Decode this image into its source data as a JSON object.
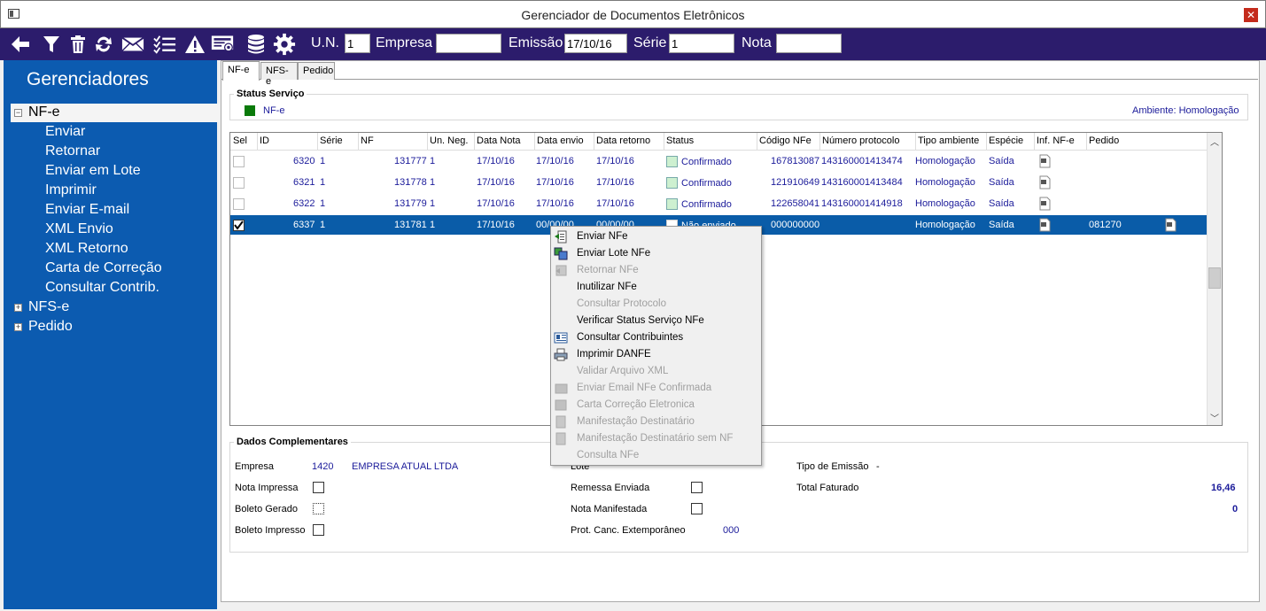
{
  "window": {
    "title": "Gerenciador de Documentos Eletrônicos",
    "close_glyph": "✕"
  },
  "toolbar": {
    "icons": [
      "back-arrow-icon",
      "filter-icon",
      "trash-icon",
      "refresh-icon",
      "envelope-icon",
      "checklist-icon",
      "warning-icon",
      "certificate-icon",
      "database-icon",
      "gear-icon"
    ],
    "un_label": "U.N.",
    "un_value": "1",
    "empresa_label": "Empresa",
    "empresa_value": "",
    "emissao_label": "Emissão",
    "emissao_value": "17/10/16",
    "serie_label": "Série",
    "serie_value": "1",
    "nota_label": "Nota",
    "nota_value": ""
  },
  "sidebar": {
    "title": "Gerenciadores",
    "nodes": [
      {
        "label": "NF-e",
        "expanded": true,
        "items": [
          "Enviar",
          "Retornar",
          "Enviar em Lote",
          "Imprimir",
          "Enviar E-mail",
          "XML Envio",
          "XML Retorno",
          "Carta de Correção",
          "Consultar Contrib."
        ]
      },
      {
        "label": "NFS-e",
        "expanded": false
      },
      {
        "label": "Pedido",
        "expanded": false
      }
    ],
    "collapse_glyph": "−",
    "expand_glyph": "+"
  },
  "tabs": [
    "NF-e",
    "NFS-e",
    "Pedido"
  ],
  "status_servico": {
    "title": "Status Serviço",
    "item_label": "NF-e",
    "ambiente": "Ambiente: Homologação",
    "color": "#0a7a0a"
  },
  "grid": {
    "columns": [
      "Sel",
      "ID",
      "Série",
      "NF",
      "Un. Neg.",
      "Data Nota",
      "Data envio",
      "Data retorno",
      "Status",
      "Código NFe",
      "Número protocolo",
      "Tipo ambiente",
      "Espécie",
      "Inf. NF-e",
      "Pedido"
    ],
    "rows": [
      {
        "sel": false,
        "id": "6320",
        "serie": "1",
        "nf": "131777",
        "un": "1",
        "data_nota": "17/10/16",
        "data_envio": "17/10/16",
        "data_retorno": "17/10/16",
        "status": "Confirmado",
        "codigo": "167813087",
        "protocolo": "143160001413474",
        "ambiente": "Homologação",
        "especie": "Saída",
        "pedido": ""
      },
      {
        "sel": false,
        "id": "6321",
        "serie": "1",
        "nf": "131778",
        "un": "1",
        "data_nota": "17/10/16",
        "data_envio": "17/10/16",
        "data_retorno": "17/10/16",
        "status": "Confirmado",
        "codigo": "121910649",
        "protocolo": "143160001413484",
        "ambiente": "Homologação",
        "especie": "Saída",
        "pedido": ""
      },
      {
        "sel": false,
        "id": "6322",
        "serie": "1",
        "nf": "131779",
        "un": "1",
        "data_nota": "17/10/16",
        "data_envio": "17/10/16",
        "data_retorno": "17/10/16",
        "status": "Confirmado",
        "codigo": "122658041",
        "protocolo": "143160001414918",
        "ambiente": "Homologação",
        "especie": "Saída",
        "pedido": ""
      },
      {
        "sel": true,
        "id": "6337",
        "serie": "1",
        "nf": "131781",
        "un": "1",
        "data_nota": "17/10/16",
        "data_envio": "00/00/00",
        "data_retorno": "00/00/00",
        "status": "Não enviado",
        "codigo": "000000000",
        "protocolo": "",
        "ambiente": "Homologação",
        "especie": "Saída",
        "pedido": "081270"
      }
    ]
  },
  "context_menu": [
    {
      "label": "Enviar NFe",
      "enabled": true,
      "icon": "send-icon"
    },
    {
      "label": "Enviar Lote NFe",
      "enabled": true,
      "icon": "send-batch-icon"
    },
    {
      "label": "Retornar NFe",
      "enabled": false,
      "icon": "return-icon"
    },
    {
      "label": "Inutilizar NFe",
      "enabled": true,
      "icon": ""
    },
    {
      "label": "Consultar Protocolo",
      "enabled": false,
      "icon": ""
    },
    {
      "label": "Verificar Status Serviço NFe",
      "enabled": true,
      "icon": ""
    },
    {
      "label": "Consultar Contribuintes",
      "enabled": true,
      "icon": "contact-card-icon"
    },
    {
      "label": "Imprimir DANFE",
      "enabled": true,
      "icon": "printer-icon"
    },
    {
      "label": "Validar Arquivo XML",
      "enabled": false,
      "icon": ""
    },
    {
      "label": "Enviar Email NFe Confirmada",
      "enabled": false,
      "icon": "email-icon"
    },
    {
      "label": "Carta Correção Eletronica",
      "enabled": false,
      "icon": "letter-icon"
    },
    {
      "label": "Manifestação Destinatário",
      "enabled": false,
      "icon": "manifest-icon"
    },
    {
      "label": "Manifestação Destinatário sem NF",
      "enabled": false,
      "icon": "manifest-icon"
    },
    {
      "label": "Consulta NFe",
      "enabled": false,
      "icon": ""
    }
  ],
  "dados": {
    "title": "Dados Complementares",
    "empresa_label": "Empresa",
    "empresa_code": "1420",
    "empresa_name": "EMPRESA ATUAL LTDA",
    "nota_impressa_label": "Nota Impressa",
    "boleto_gerado_label": "Boleto Gerado",
    "boleto_impresso_label": "Boleto Impresso",
    "lote_label": "Lote",
    "remessa_label": "Remessa Enviada",
    "nota_manifestada_label": "Nota Manifestada",
    "prot_label": "Prot. Canc. Extemporâneo",
    "prot_value": "000",
    "tipo_emissao_label": "Tipo de Emissão",
    "tipo_emissao_value": "-",
    "total_label": "Total Faturado",
    "total_value": "16,46",
    "extra_value": "0"
  }
}
